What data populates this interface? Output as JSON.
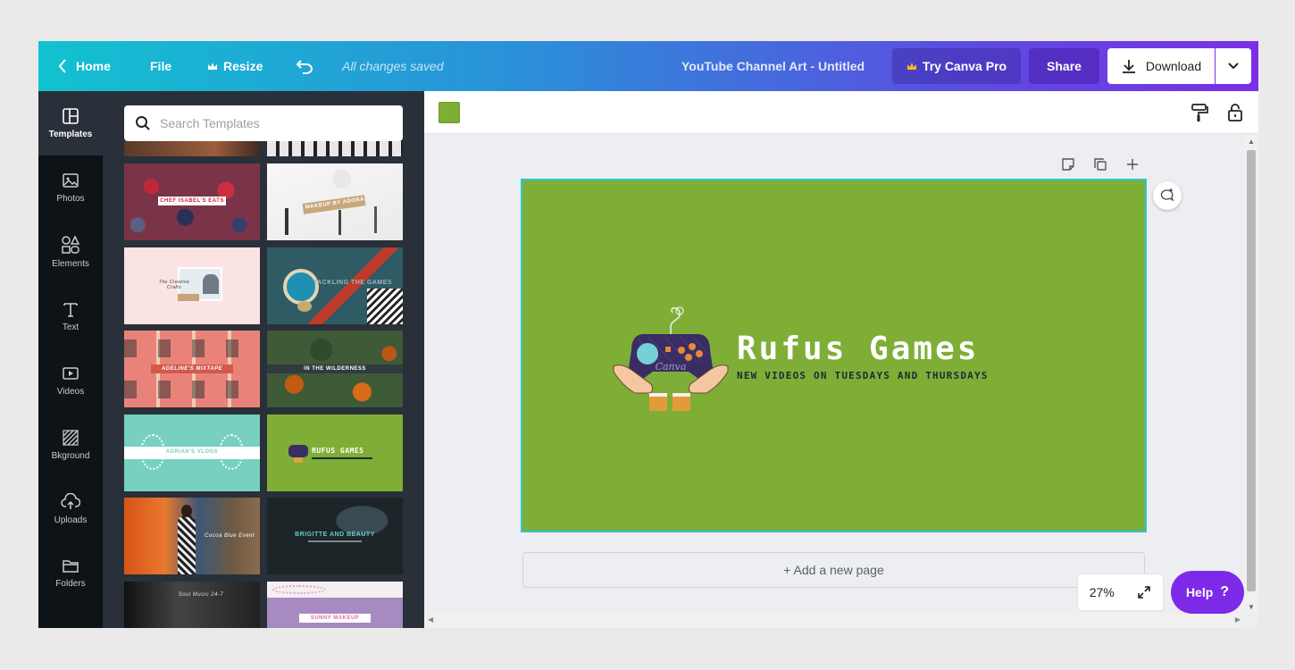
{
  "topbar": {
    "home_label": "Home",
    "file_label": "File",
    "resize_label": "Resize",
    "saved_status": "All changes saved",
    "doc_title": "YouTube Channel Art - Untitled",
    "pro_label": "Try Canva Pro",
    "share_label": "Share",
    "download_label": "Download"
  },
  "rail": {
    "items": [
      {
        "label": "Templates",
        "icon": "templates-icon"
      },
      {
        "label": "Photos",
        "icon": "photos-icon"
      },
      {
        "label": "Elements",
        "icon": "elements-icon"
      },
      {
        "label": "Text",
        "icon": "text-icon"
      },
      {
        "label": "Videos",
        "icon": "videos-icon"
      },
      {
        "label": "Bkground",
        "icon": "background-icon"
      },
      {
        "label": "Uploads",
        "icon": "uploads-icon"
      },
      {
        "label": "Folders",
        "icon": "folders-icon"
      }
    ]
  },
  "panel": {
    "search_placeholder": "Search Templates",
    "templates": [
      {
        "label": "CHEF ISABEL'S EATS"
      },
      {
        "label": "MAKEUP BY ADORA"
      },
      {
        "label": "The Creative Crafts"
      },
      {
        "label": "TACKLING THE GAMES"
      },
      {
        "label": "ADELINE'S MIXTAPE"
      },
      {
        "label": "IN THE WILDERNESS"
      },
      {
        "label": "ADRIAN'S VLOGS"
      },
      {
        "label": "RUFUS GAMES"
      },
      {
        "label": "Cocoa Blue Event"
      },
      {
        "label": "BRIGITTE AND BEAUTY"
      },
      {
        "label": "Soul Music 24-7"
      },
      {
        "label": "SUNNY MAKEUP"
      }
    ]
  },
  "editor": {
    "bg_color": "#7fae37",
    "zoom": "27%",
    "add_page_label": "+ Add a new page",
    "help_label": "Help",
    "help_icon": "?"
  },
  "design": {
    "logo_word": "Canva",
    "title": "Rufus Games",
    "subtitle": "NEW VIDEOS ON TUESDAYS AND THURSDAYS"
  },
  "colors": {
    "accent": "#7d2ae8",
    "canvas_green": "#7fae37",
    "selection": "#27c6d6"
  }
}
